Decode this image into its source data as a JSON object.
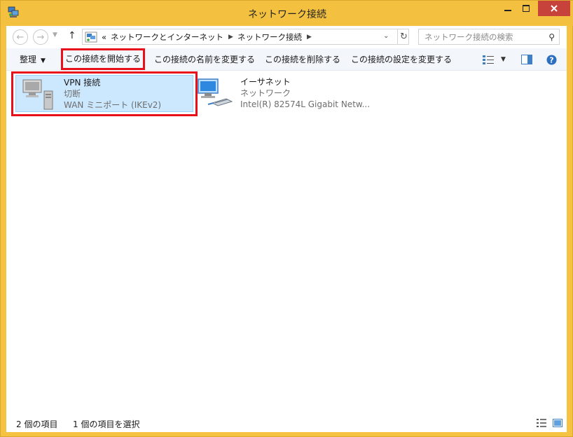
{
  "window": {
    "title": "ネットワーク接続",
    "accent": "#f3c13f",
    "close_color": "#c7423a"
  },
  "nav": {
    "back_icon": "back-arrow-icon",
    "forward_icon": "forward-arrow-icon",
    "up_icon": "up-arrow-icon"
  },
  "address": {
    "overflow": "«",
    "crumbs": [
      "ネットワークとインターネット",
      "ネットワーク接続"
    ]
  },
  "search": {
    "placeholder": "ネットワーク接続の検索"
  },
  "toolbar": {
    "organize_label": "整理",
    "start_label": "この接続を開始する",
    "rename_label": "この接続の名前を変更する",
    "delete_label": "この接続を削除する",
    "settings_label": "この接続の設定を変更する",
    "highlight_color": "#e8101b"
  },
  "connections": [
    {
      "name": "VPN 接続",
      "status": "切断",
      "device": "WAN ミニポート (IKEv2)",
      "selected": true
    },
    {
      "name": "イーサネット",
      "status": "ネットワーク",
      "device": "Intel(R) 82574L Gigabit Netw...",
      "selected": false
    }
  ],
  "statusbar": {
    "count": "2 個の項目",
    "selected": "1 個の項目を選択"
  }
}
